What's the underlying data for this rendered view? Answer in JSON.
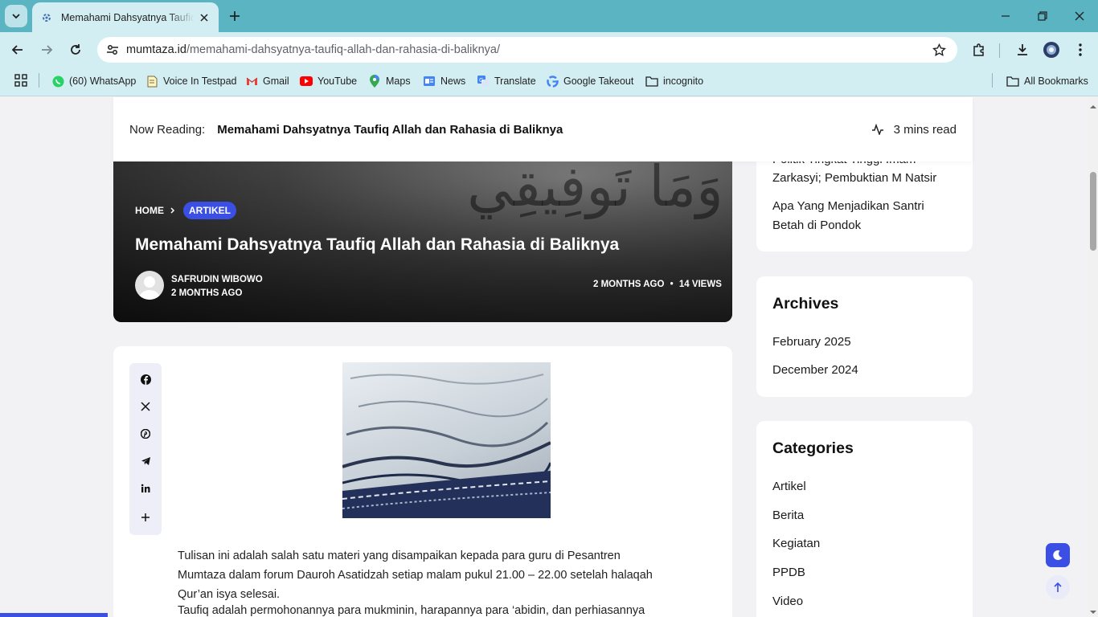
{
  "browser": {
    "tab_title": "Memahami Dahsyatnya Taufiq Allah dan Rahasia di Baliknya",
    "url_domain": "mumtaza.id",
    "url_path": "/memahami-dahsyatnya-taufiq-allah-dan-rahasia-di-baliknya/",
    "bookmarks": [
      {
        "label": "(60) WhatsApp",
        "icon": "whatsapp-icon"
      },
      {
        "label": "Voice In Testpad",
        "icon": "notepad-icon"
      },
      {
        "label": "Gmail",
        "icon": "gmail-icon"
      },
      {
        "label": "YouTube",
        "icon": "youtube-icon"
      },
      {
        "label": "Maps",
        "icon": "maps-icon"
      },
      {
        "label": "News",
        "icon": "news-icon"
      },
      {
        "label": "Translate",
        "icon": "translate-icon"
      },
      {
        "label": "Google Takeout",
        "icon": "google-icon"
      },
      {
        "label": "incognito",
        "icon": "folder-icon"
      }
    ],
    "all_bookmarks": "All Bookmarks"
  },
  "reading_bar": {
    "label": "Now Reading:",
    "title": "Memahami Dahsyatnya Taufiq Allah dan Rahasia di Baliknya",
    "read_time": "3 mins read"
  },
  "hero": {
    "breadcrumb_home": "HOME",
    "category": "ARTIKEL",
    "title": "Memahami Dahsyatnya Taufiq Allah dan Rahasia di Baliknya",
    "author": "SAFRUDIN WIBOWO",
    "author_date": "2 MONTHS AGO",
    "posted": "2 MONTHS AGO",
    "views": "14 VIEWS"
  },
  "article": {
    "paragraph1_line1": "Tulisan ini adalah salah satu materi yang disampaikan kepada para guru di Pesantren",
    "paragraph1_line2": "Mumtaza dalam forum Dauroh Asatidzah setiap malam pukul 21.00 – 22.00 setelah halaqah",
    "paragraph1_line3": "Qur’an isya selesai.",
    "paragraph2_line1": "Taufiq adalah permohonannya para mukminin, harapannya para ‘abidin, dan perhiasannya"
  },
  "sidebar": {
    "recent_cut": "Politik Tingkat Tinggi Imam",
    "recent_1_line2": "Zarkasyi; Pembuktian M Natsir",
    "recent_2_line1": "Apa Yang Menjadikan Santri",
    "recent_2_line2": "Betah di Pondok",
    "archives_title": "Archives",
    "archives": [
      "February 2025",
      "December 2024"
    ],
    "categories_title": "Categories",
    "categories": [
      "Artikel",
      "Berita",
      "Kegiatan",
      "PPDB",
      "Video"
    ]
  },
  "colors": {
    "accent": "#3b4fe4",
    "browser_frame": "#5ab4c2",
    "toolbar": "#d3eef2"
  }
}
